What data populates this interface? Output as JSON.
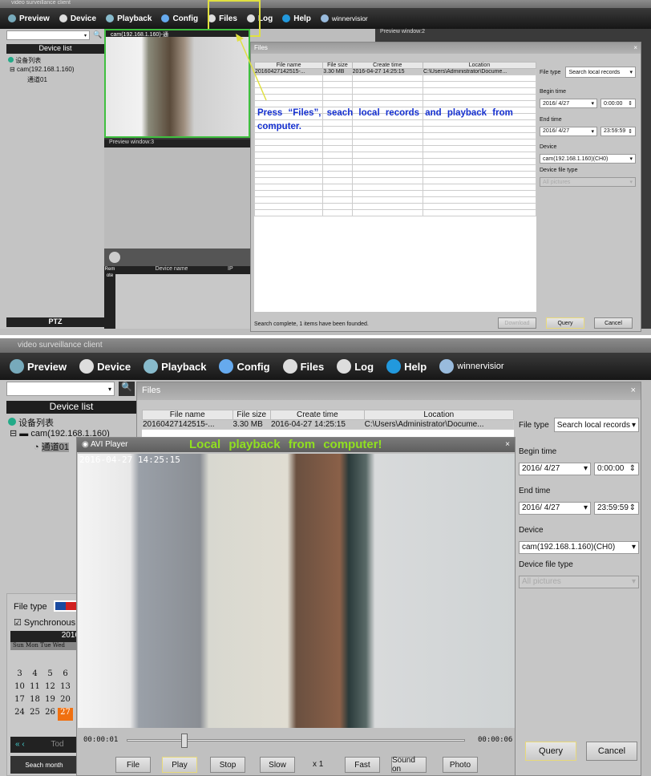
{
  "app_title": "video surveillance client",
  "toolbar": {
    "items": [
      {
        "label": "Preview",
        "icon": "monitor-icon"
      },
      {
        "label": "Device",
        "icon": "arrow-icon"
      },
      {
        "label": "Playback",
        "icon": "film-reel-icon"
      },
      {
        "label": "Config",
        "icon": "gear-icon"
      },
      {
        "label": "Files",
        "icon": "arrow-icon"
      },
      {
        "label": "Log",
        "icon": "arrow-icon"
      },
      {
        "label": "Help",
        "icon": "help-icon"
      },
      {
        "label": "winnervisior",
        "icon": "user-icon"
      }
    ]
  },
  "device_list": {
    "title": "Device list",
    "root": "设备列表",
    "device": "cam(192.168.1.160)",
    "channel": "通道01"
  },
  "preview": {
    "window1": "cam(192.168.1.160)-通",
    "window2": "Preview window:2",
    "window3": "Preview window:3",
    "timestamp": "2016-04-27 14:25:15"
  },
  "top_side": {
    "device_name_col": "Device name",
    "ip_col": "IP",
    "remote_tab": "Remote",
    "local_tab": "Local",
    "ptz": "PTZ"
  },
  "files_dialog": {
    "title": "Files",
    "columns": [
      "File name",
      "File size",
      "Create time",
      "Location"
    ],
    "rows": [
      [
        "20160427142515-...",
        "3.30 MB",
        "2016-04-27 14:25:15",
        "C:\\Users\\Administrator\\Docume..."
      ]
    ],
    "file_type_label": "File type",
    "file_type_value": "Search local records",
    "begin_time_label": "Begin time",
    "begin_date": "2016/ 4/27",
    "begin_time": "0:00:00",
    "end_time_label": "End time",
    "end_date": "2016/ 4/27",
    "end_time": "23:59:59",
    "device_label": "Device",
    "device_value": "cam(192.168.1.160)(CH0)",
    "device_file_type_label": "Device file type",
    "device_file_type_value": "All pictures",
    "status": "Search complete, 1 items have been founded.",
    "download": "Download",
    "query": "Query",
    "cancel": "Cancel"
  },
  "annotation_top": "Press “Files”, seach local records and playback from computer.",
  "annotation_bottom": "Local playback from computer!",
  "playback_side": {
    "file_type_label": "File type",
    "sync_label": "Synchronous p",
    "sync_checked": true,
    "year": "2016",
    "weekdays": "Sun Mon Tue Wed",
    "weeks": [
      [
        "3",
        "4",
        "5",
        "6"
      ],
      [
        "10",
        "11",
        "12",
        "13"
      ],
      [
        "17",
        "18",
        "19",
        "20"
      ],
      [
        "24",
        "25",
        "26",
        "27"
      ]
    ],
    "selected_day": "27",
    "today": "Tod",
    "search_month": "Seach month"
  },
  "avi_player": {
    "title": "AVI Player",
    "current_time": "00:00:01",
    "total_time": "00:00:06",
    "progress_fraction": 0.2,
    "buttons": [
      "File",
      "Play",
      "Stop",
      "Slow",
      "Fast",
      "Sound on",
      "Photo"
    ],
    "speed": "x 1"
  },
  "colors": {
    "highlight": "#e0e040",
    "preview_border": "#40c040",
    "annotation_blue": "#1530d0",
    "annotation_green": "#90e020",
    "selected_day": "#f07010"
  }
}
